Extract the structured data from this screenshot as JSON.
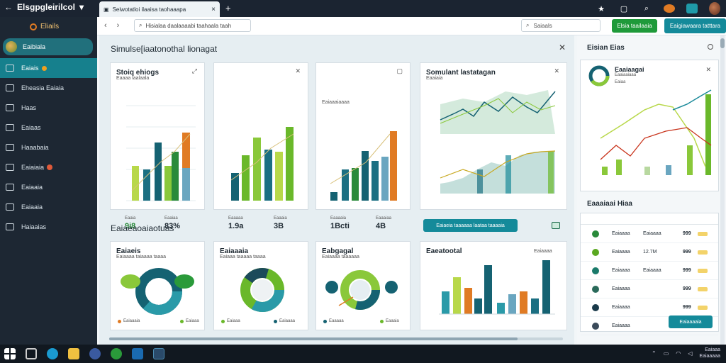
{
  "window": {
    "title": "Elsgpgleirilcol",
    "tab_title": "Seiwotatloi ilaaisa taohaaapa",
    "url": "Hisialaa daalaaaabi taahaala taah",
    "search": "Saiaals",
    "btn_green": "Elsia taailaaia",
    "btn_teal": "Eaigiawaara tatttara"
  },
  "sidebar": {
    "brand": "Eliails",
    "profile": "Eaibiala",
    "items": [
      {
        "label": "Eaiais",
        "active": true,
        "badge": "orange"
      },
      {
        "label": "Eheasia Eaiaia",
        "active": false,
        "badge": ""
      },
      {
        "label": "Haas",
        "active": false,
        "badge": ""
      },
      {
        "label": "Eaiaas",
        "active": false,
        "badge": ""
      },
      {
        "label": "Haaabaia",
        "active": false,
        "badge": ""
      },
      {
        "label": "Eaiaiaia",
        "active": false,
        "badge": "red"
      },
      {
        "label": "Eaiaaia",
        "active": false,
        "badge": ""
      },
      {
        "label": "Eaiaaia",
        "active": false,
        "badge": ""
      },
      {
        "label": "Haiaaias",
        "active": false,
        "badge": ""
      }
    ]
  },
  "main": {
    "title": "Simulse[iaatonothal lionagat",
    "section2": "Eaiaeaoaiaotuas",
    "section2_button": "Eaiaeia taaaaaa laataa taaaaia",
    "cards": [
      {
        "title": "Stoiq ehiogs",
        "sub": "Eaaaa laalaala",
        "stat1": "9i8",
        "stat2": "83%",
        "lbl1": "Eaaia",
        "lbl2": "Eaaiaa"
      },
      {
        "title": "",
        "sub": "",
        "stat1": "1.9a",
        "stat2": "3B",
        "lbl1": "Eaaaaa",
        "lbl2": "Eaaaia"
      },
      {
        "title": "",
        "sub": "Eaiaaaiaaaa",
        "stat1": "1Bcti",
        "stat2": "4B",
        "lbl1": "Eaaaaia",
        "lbl2": "Eaaaiaa"
      },
      {
        "title": "Somulant lastatagan",
        "sub": "Eaaiaia",
        "stat1": "",
        "stat2": "",
        "lbl1": "",
        "lbl2": ""
      }
    ],
    "cards2": [
      {
        "title": "Eaiaeis",
        "sub": "Eaiaaaa taiaaaa taaaa",
        "lbl1": "Eaiaaaia",
        "lbl2": "Eaiaaa"
      },
      {
        "title": "Eaiaaaia",
        "sub": "Eaiaaa taaaaa taaaa",
        "lbl1": "Eaiaaa",
        "lbl2": "Eaiaaaa"
      },
      {
        "title": "Eabgagal",
        "sub": "Eaiaaaa taaaaaa",
        "lbl1": "Eaaaaa",
        "lbl2": "Eaaaia"
      },
      {
        "title": "Eaeatootal",
        "sub": "Eaiaaaa",
        "lbl1": "",
        "lbl2": ""
      }
    ]
  },
  "right": {
    "title": "Eisian Eias",
    "card_title": "Eaaiaagai",
    "card_sub": "Eaaiaaiaaa",
    "card_sub2": "Eaiaa",
    "table_title": "Eaaaiaai Hiaa",
    "table_button": "Eaiaaaaia",
    "rows": [
      {
        "name": "Eaiaaaa",
        "val": "Eaiaaaa",
        "num": "999",
        "color": "#2a8a3a"
      },
      {
        "name": "Eaiaaaa",
        "val": "12.7M",
        "num": "999",
        "color": "#5aa820"
      },
      {
        "name": "Eaiaaaa",
        "val": "Eaiaaaa",
        "num": "999",
        "color": "#1a7a6a"
      },
      {
        "name": "Eaiaaaa",
        "val": "",
        "num": "999",
        "color": "#2a6a5a"
      },
      {
        "name": "Eaiaaaa",
        "val": "",
        "num": "999",
        "color": "#1a3a4a"
      },
      {
        "name": "Eaiaaaa",
        "val": "",
        "num": "",
        "color": "#3a4a5a"
      }
    ]
  },
  "taskbar": {
    "time": "Eaiaaa",
    "date": "Eaiaaaaa"
  },
  "colors": {
    "teal": "#148a9a",
    "green": "#6ab82a",
    "orange": "#e07b24",
    "dark": "#1d2733"
  }
}
